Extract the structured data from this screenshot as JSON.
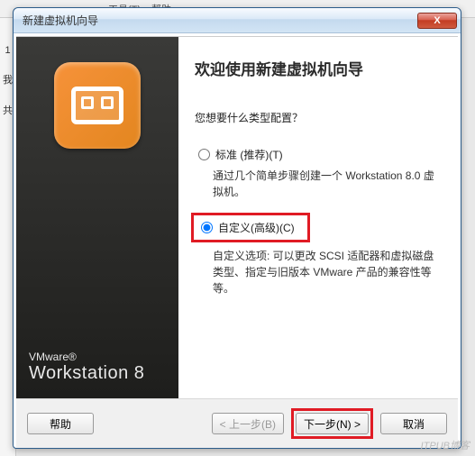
{
  "bg": {
    "menu1": "工具(T)",
    "menu2": "帮助",
    "side1": "1",
    "side2": "我",
    "side3": "共"
  },
  "titlebar": {
    "title": "新建虚拟机向导",
    "close": "X"
  },
  "brand": {
    "small": "VMware®",
    "big": "Workstation 8"
  },
  "wizard": {
    "heading": "欢迎使用新建虚拟机向导",
    "question": "您想要什么类型配置？",
    "opt_typical": {
      "label": "标准 (推荐)(T)",
      "desc": "通过几个简单步骤创建一个 Workstation 8.0 虚拟机。",
      "checked": false
    },
    "opt_custom": {
      "label": "自定义(高级)(C)",
      "desc": "自定义选项: 可以更改 SCSI 适配器和虚拟磁盘类型、指定与旧版本 VMware 产品的兼容性等等。",
      "checked": true
    }
  },
  "buttons": {
    "help": "帮助",
    "back": "< 上一步(B)",
    "next": "下一步(N) >",
    "cancel": "取消"
  },
  "watermark": "ITPUB博客"
}
